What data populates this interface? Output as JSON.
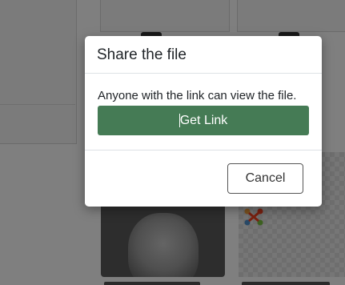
{
  "modal": {
    "title": "Share the file",
    "body_text": "Anyone with the link can view the file.",
    "get_link_label": "Get Link",
    "cancel_label": "Cancel"
  },
  "colors": {
    "primary_button": "#457b55",
    "backdrop": "rgba(0,0,0,0.5)"
  }
}
